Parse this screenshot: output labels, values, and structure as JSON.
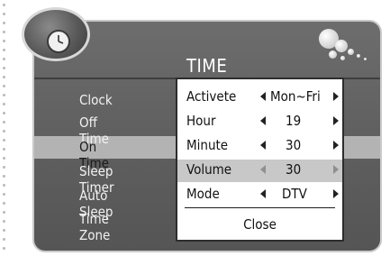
{
  "header": {
    "title": "TIME"
  },
  "menu": {
    "items": [
      {
        "label": "Clock"
      },
      {
        "label": "Off Time"
      },
      {
        "label": "On Time",
        "selected": true
      },
      {
        "label": "Sleep Timer"
      },
      {
        "label": "Auto Sleep"
      },
      {
        "label": "Time Zone"
      }
    ]
  },
  "popup": {
    "rows": [
      {
        "label": "Activete",
        "value": "Mon~Fri"
      },
      {
        "label": "Hour",
        "value": "19"
      },
      {
        "label": "Minute",
        "value": "30"
      },
      {
        "label": "Volume",
        "value": "30",
        "highlighted": true
      },
      {
        "label": "Mode",
        "value": "DTV"
      }
    ],
    "close_label": "Close"
  },
  "icons": [
    "clock-icon",
    "bubbles-logo-icon",
    "left-arrow-icon",
    "right-arrow-icon"
  ]
}
